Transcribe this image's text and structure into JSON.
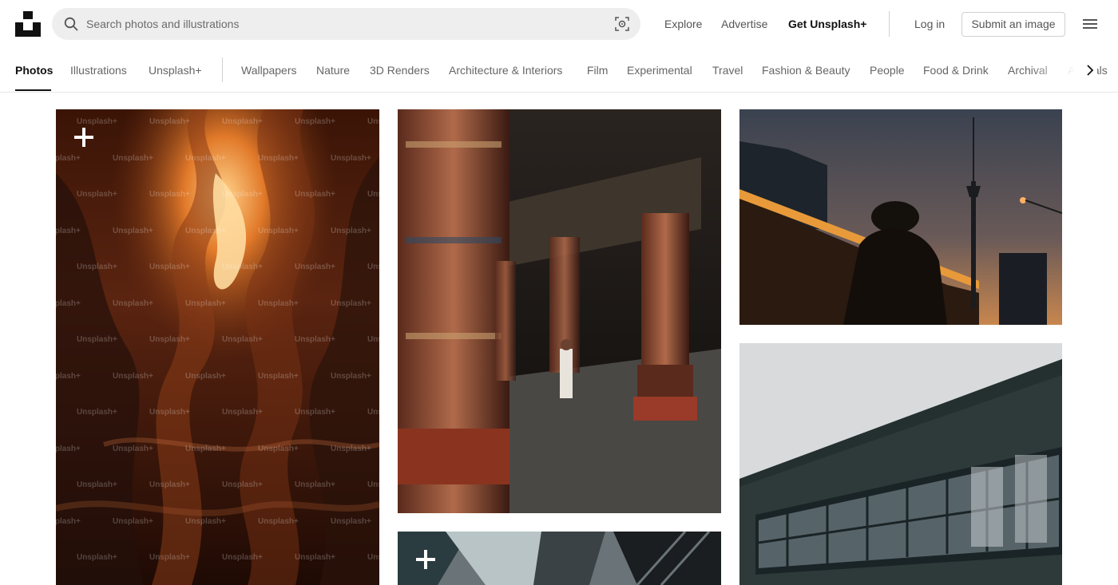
{
  "header": {
    "search_placeholder": "Search photos and illustrations",
    "links": {
      "explore": "Explore",
      "advertise": "Advertise",
      "get_plus": "Get Unsplash+",
      "login": "Log in",
      "submit": "Submit an image"
    }
  },
  "topics": {
    "items": [
      "Photos",
      "Illustrations",
      "Unsplash+",
      "Wallpapers",
      "Nature",
      "3D Renders",
      "Architecture & Interiors",
      "Film",
      "Experimental",
      "Travel",
      "Fashion & Beauty",
      "People",
      "Food & Drink",
      "Archival",
      "Animals"
    ],
    "active": "Photos"
  },
  "watermark": "Unsplash+",
  "colors": {
    "search_bg": "#eeeeee",
    "text_primary": "#111111",
    "text_secondary": "#555555",
    "divider": "#d1d1d1"
  }
}
